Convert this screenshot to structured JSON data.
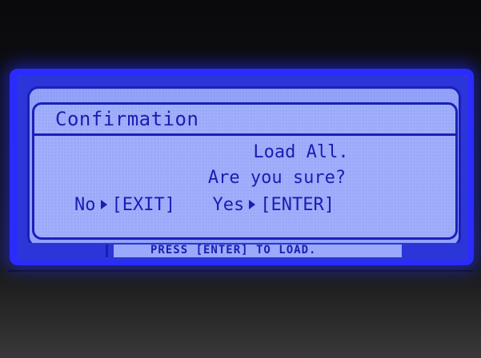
{
  "dialog": {
    "title": "Confirmation",
    "message_line1": "Load All.",
    "message_line2": "Are you sure?",
    "no_label": "No",
    "no_key": "[EXIT]",
    "yes_label": "Yes",
    "yes_key": "[ENTER]"
  },
  "status_bar": {
    "text": "PRESS [ENTER] TO LOAD."
  },
  "colors": {
    "backlight": "#2a2cff",
    "lcd_background": "#9aa9fa",
    "lcd_ink": "#1a1db0"
  },
  "icons": {
    "option_arrow": "triangle-right-icon"
  }
}
